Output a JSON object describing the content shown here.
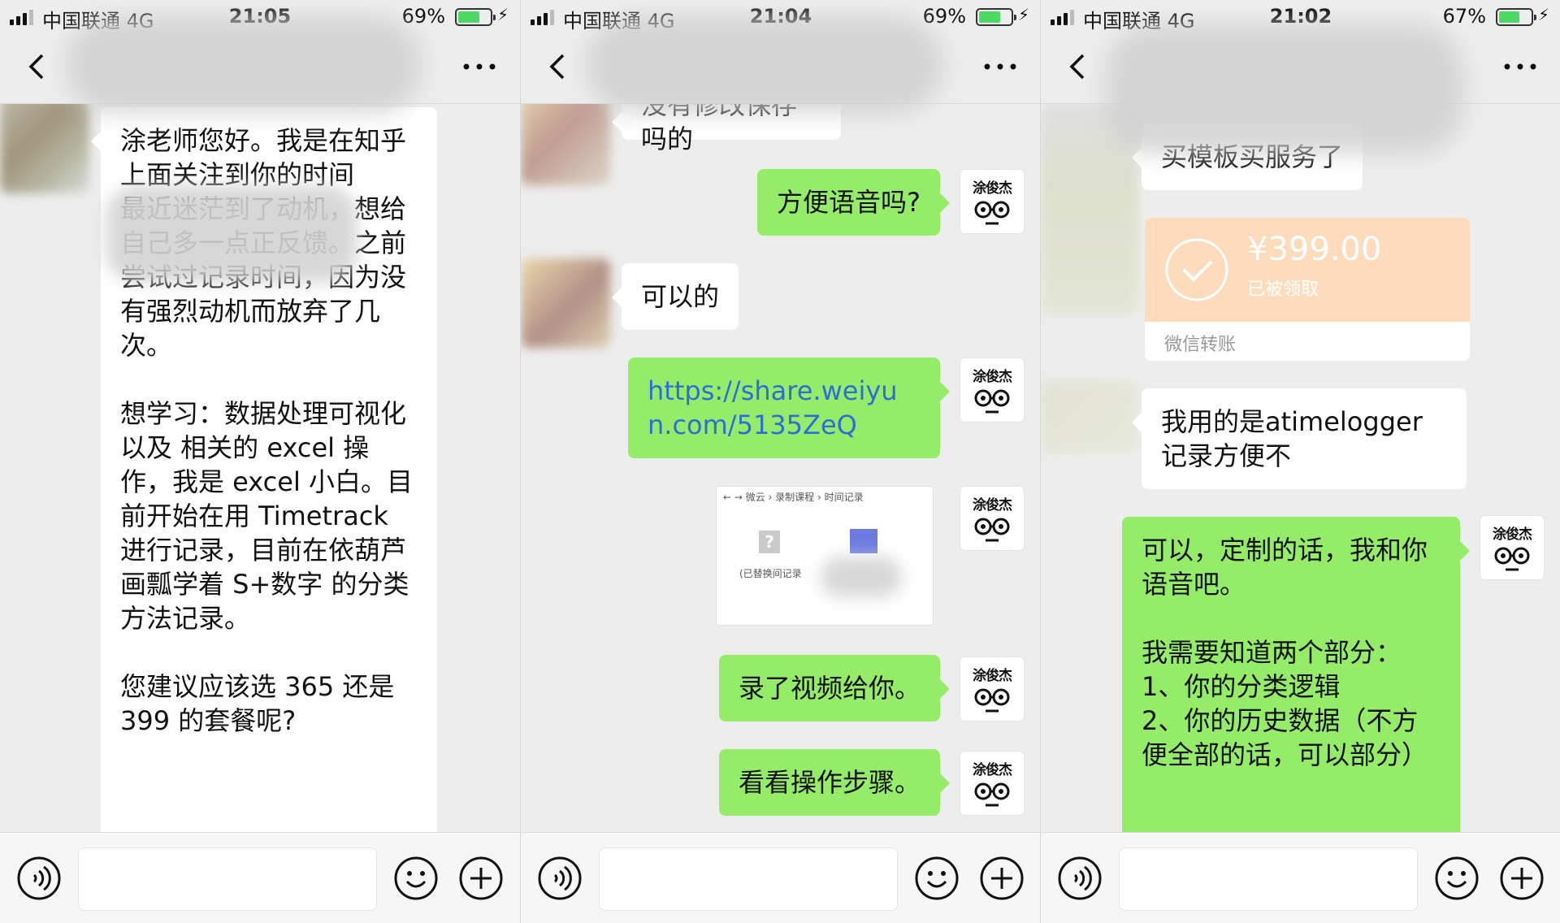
{
  "colors": {
    "outgoing_bubble": "#95ec69",
    "incoming_bubble": "#ffffff",
    "background": "#ededed",
    "link": "#2b6fd6",
    "transfer_card": "#fcdcbc"
  },
  "panels": [
    {
      "status": {
        "carrier": "中国联通 4G",
        "time": "21:05",
        "battery": "69%",
        "battery_level": 0.69
      },
      "messages": [
        {
          "side": "in",
          "text": "涂老师您好。我是在知乎上面关注到你的时间\n最近迷茫到了动机，想给自己多一点正反馈。之前尝试过记录时间，因为没有强烈动机而放弃了几次。\n\n想学习：数据处理可视化 以及 相关的 excel 操作，我是 excel 小白。目前开始在用 Timetrack 进行记录，目前在依葫芦画瓢学着 S+数字 的分类方法记录。\n\n您建议应该选 365 还是 399 的套餐呢?"
        }
      ]
    },
    {
      "status": {
        "carrier": "中国联通 4G",
        "time": "21:04",
        "battery": "69%",
        "battery_level": 0.69
      },
      "messages": [
        {
          "side": "in",
          "text": "没有修改保存吗的"
        },
        {
          "side": "out",
          "text": "方便语音吗?",
          "sender": "涂俊杰"
        },
        {
          "side": "in",
          "text": "可以的"
        },
        {
          "side": "out",
          "text": "https://share.weiyun.com/5135ZeQ",
          "sender": "涂俊杰"
        },
        {
          "side": "out",
          "type": "file",
          "crumbs": "← → 微云 › 录制课程 › 时间记录",
          "file_label": "(已替换间记录",
          "sender": "涂俊杰"
        },
        {
          "side": "out",
          "text": "录了视频给你。",
          "sender": "涂俊杰"
        },
        {
          "side": "out",
          "text": "看看操作步骤。",
          "sender": "涂俊杰"
        }
      ]
    },
    {
      "status": {
        "carrier": "中国联通 4G",
        "time": "21:02",
        "battery": "67%",
        "battery_level": 0.67
      },
      "messages": [
        {
          "side": "in",
          "text": "买模板买服务了"
        },
        {
          "side": "in",
          "type": "transfer",
          "amount": "¥399.00",
          "status": "已被领取",
          "footer": "微信转账"
        },
        {
          "side": "in",
          "text": "我用的是atimelogger记录方便不"
        },
        {
          "side": "out",
          "text": "可以，定制的话，我和你语音吧。\n\n我需要知道两个部分：\n1、你的分类逻辑\n2、你的历史数据（不方便全部的话，可以部分）",
          "sender": "涂俊杰"
        }
      ]
    }
  ]
}
